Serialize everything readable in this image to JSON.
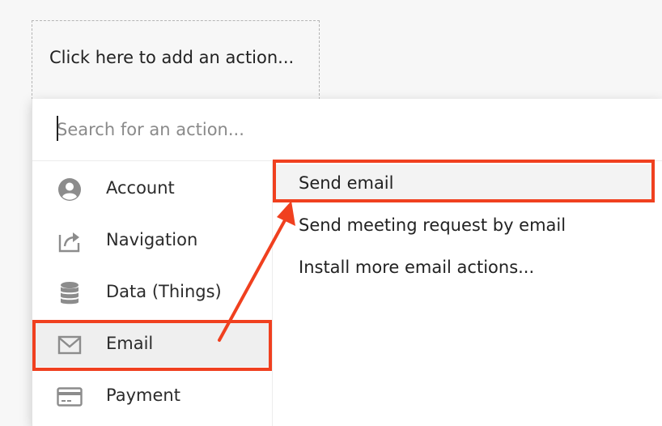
{
  "add_action": {
    "label": "Click here to add an action..."
  },
  "search": {
    "placeholder": "Search for an action..."
  },
  "categories": [
    {
      "label": "Account",
      "icon": "user-circle-icon"
    },
    {
      "label": "Navigation",
      "icon": "share-arrow-icon"
    },
    {
      "label": "Data (Things)",
      "icon": "database-icon"
    },
    {
      "label": "Email",
      "icon": "envelope-icon",
      "selected": true
    },
    {
      "label": "Payment",
      "icon": "credit-card-icon"
    }
  ],
  "actions": [
    {
      "label": "Send email",
      "highlighted": true
    },
    {
      "label": "Send meeting request by email"
    },
    {
      "label": "Install more email actions..."
    }
  ],
  "colors": {
    "annotation": "#f0401f",
    "icon": "#8c8c8c"
  }
}
